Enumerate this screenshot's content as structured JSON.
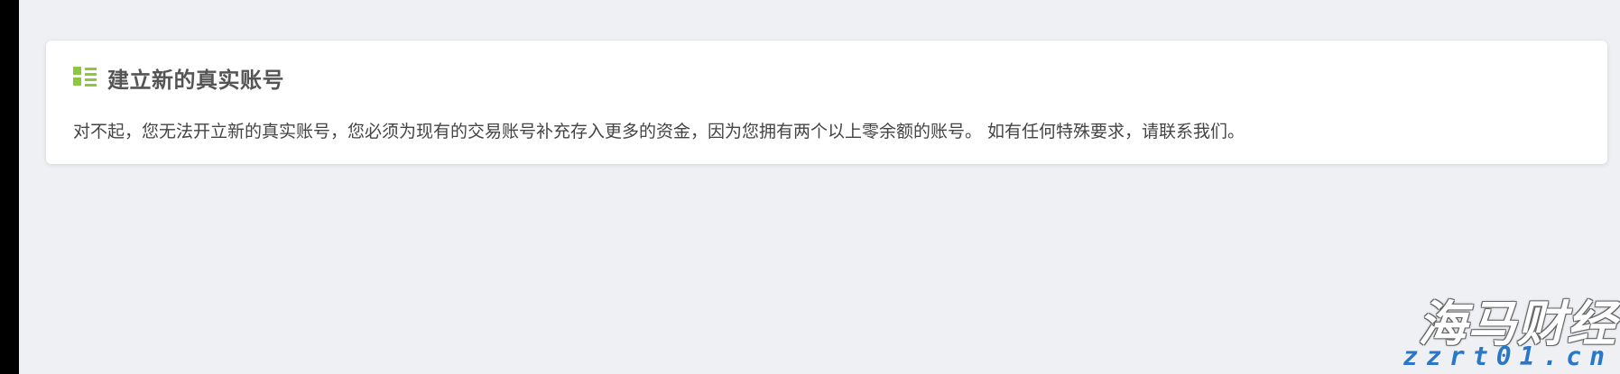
{
  "panel": {
    "icon": "list-icon",
    "title": "建立新的真实账号",
    "message": "对不起，您无法开立新的真实账号，您必须为现有的交易账号补充存入更多的资金，因为您拥有两个以上零余额的账号。 如有任何特殊要求，请联系我们。"
  },
  "watermark": {
    "logo_text": "海马财经",
    "url": "zzrt01.cn"
  },
  "colors": {
    "accent_icon": "#8dc63f",
    "page_background": "#eef0f4",
    "card_background": "#ffffff",
    "title_text": "#555555",
    "body_text": "#444444",
    "watermark_url": "#2a77c9"
  }
}
